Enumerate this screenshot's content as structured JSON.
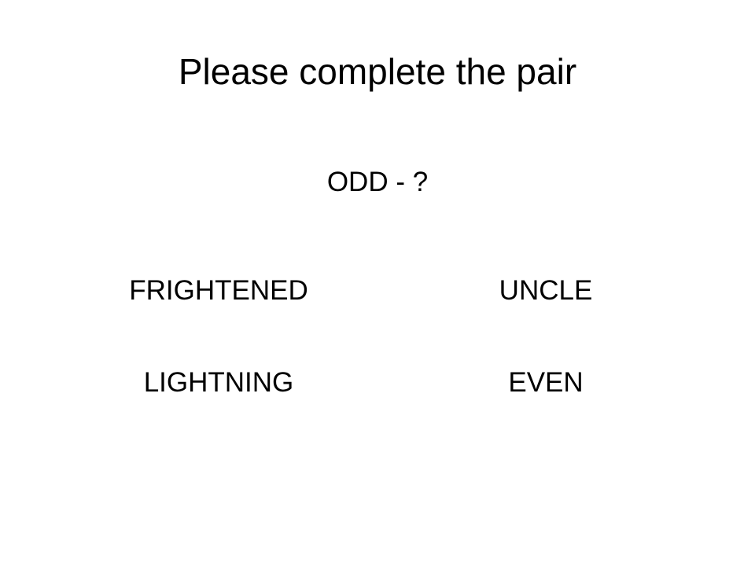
{
  "slide": {
    "title": "Please complete the pair",
    "question": "ODD - ?",
    "options": [
      "FRIGHTENED",
      "UNCLE",
      "LIGHTNING",
      "EVEN"
    ]
  }
}
